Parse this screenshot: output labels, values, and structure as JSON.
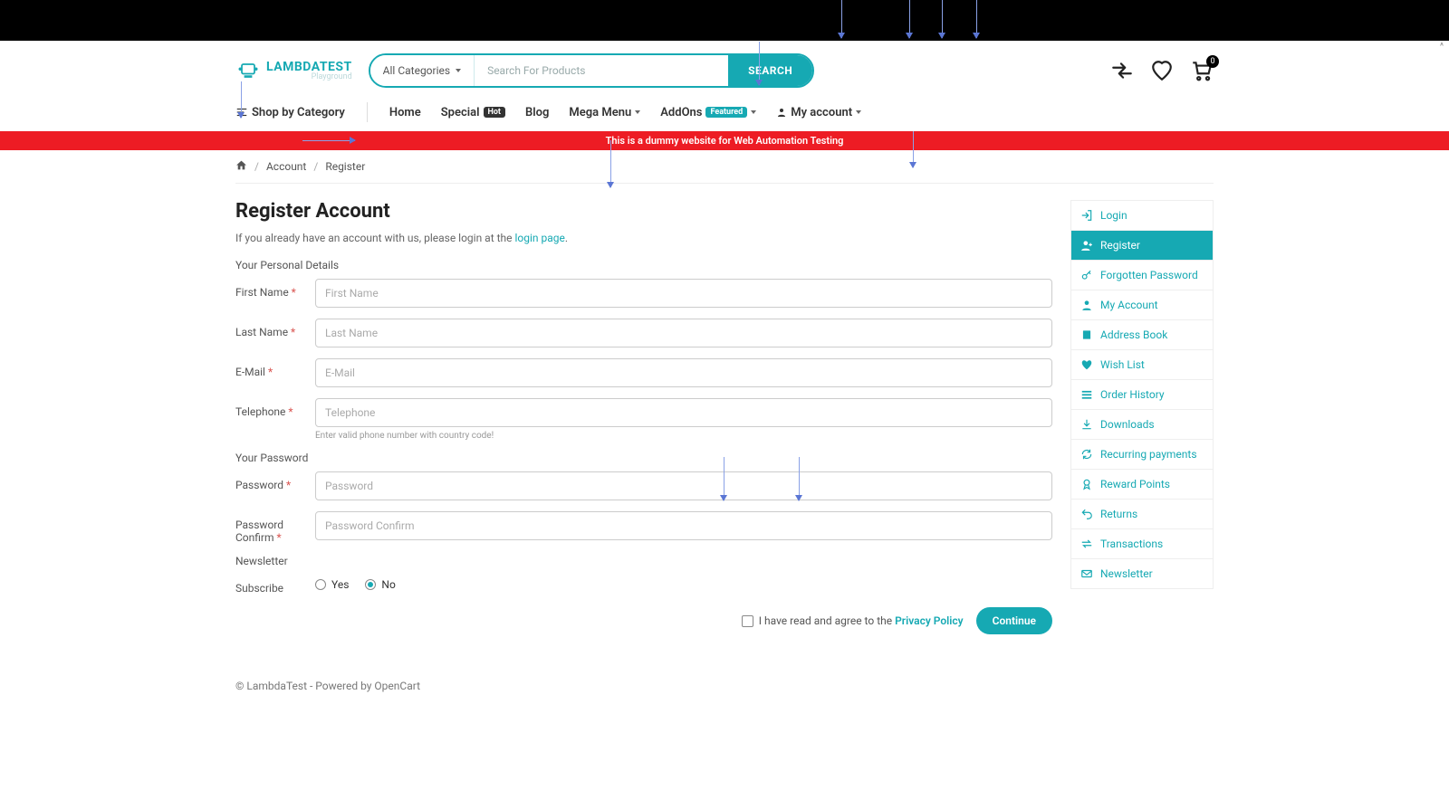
{
  "header": {
    "logo_main": "LAMBDATEST",
    "logo_sub": "Playground",
    "search": {
      "category": "All Categories",
      "placeholder": "Search For Products",
      "button": "SEARCH"
    },
    "cart_count": "0"
  },
  "nav": {
    "shop_by": "Shop by Category",
    "items": [
      {
        "label": "Home"
      },
      {
        "label": "Special",
        "badge": "Hot",
        "badge_style": "dark"
      },
      {
        "label": "Blog"
      },
      {
        "label": "Mega Menu",
        "caret": true
      },
      {
        "label": "AddOns",
        "badge": "Featured",
        "badge_style": "teal",
        "caret": true
      },
      {
        "label": "My account",
        "icon": "user",
        "caret": true
      }
    ]
  },
  "banner": "This is a dummy website for Web Automation Testing",
  "breadcrumb": {
    "account": "Account",
    "register": "Register"
  },
  "page": {
    "title": "Register Account",
    "subtext_prefix": "If you already have an account with us, please login at the ",
    "subtext_link": "login page",
    "subtext_suffix": "."
  },
  "sections": {
    "personal": "Your Personal Details",
    "password": "Your Password",
    "newsletter": "Newsletter"
  },
  "fields": {
    "first_name": {
      "label": "First Name",
      "placeholder": "First Name"
    },
    "last_name": {
      "label": "Last Name",
      "placeholder": "Last Name"
    },
    "email": {
      "label": "E-Mail",
      "placeholder": "E-Mail"
    },
    "telephone": {
      "label": "Telephone",
      "placeholder": "Telephone",
      "help": "Enter valid phone number with country code!"
    },
    "password": {
      "label": "Password",
      "placeholder": "Password"
    },
    "confirm": {
      "label": "Password Confirm",
      "placeholder": "Password Confirm"
    },
    "subscribe": {
      "label": "Subscribe",
      "yes": "Yes",
      "no": "No"
    }
  },
  "agree": {
    "text": "I have read and agree to the ",
    "link": "Privacy Policy"
  },
  "continue": "Continue",
  "sidebar": [
    {
      "label": "Login",
      "icon": "login"
    },
    {
      "label": "Register",
      "icon": "user-plus",
      "active": true
    },
    {
      "label": "Forgotten Password",
      "icon": "key"
    },
    {
      "label": "My Account",
      "icon": "user"
    },
    {
      "label": "Address Book",
      "icon": "book"
    },
    {
      "label": "Wish List",
      "icon": "heart"
    },
    {
      "label": "Order History",
      "icon": "list"
    },
    {
      "label": "Downloads",
      "icon": "download"
    },
    {
      "label": "Recurring payments",
      "icon": "sync"
    },
    {
      "label": "Reward Points",
      "icon": "award"
    },
    {
      "label": "Returns",
      "icon": "undo"
    },
    {
      "label": "Transactions",
      "icon": "exchange"
    },
    {
      "label": "Newsletter",
      "icon": "mail"
    }
  ],
  "footer": "© LambdaTest - Powered by OpenCart",
  "scroll_hint": "^"
}
